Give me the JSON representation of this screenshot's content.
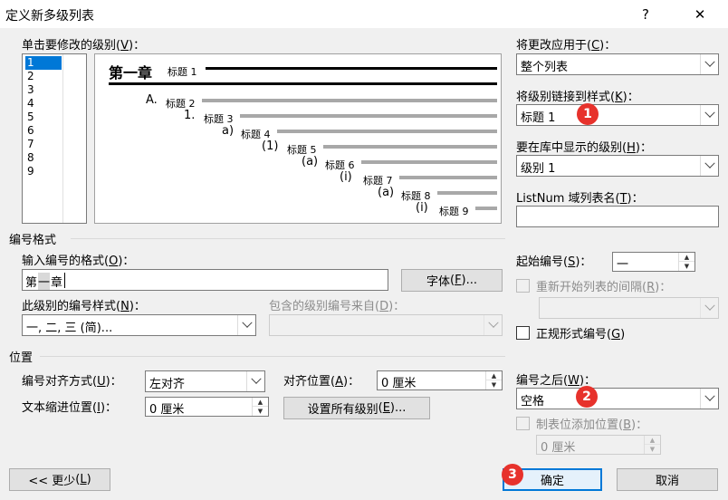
{
  "window": {
    "title": "定义新多级列表",
    "help": "?",
    "close": "✕"
  },
  "level_click": {
    "label": "单击要修改的级别",
    "key": "V",
    "suffix": "："
  },
  "levels": [
    "1",
    "2",
    "3",
    "4",
    "5",
    "6",
    "7",
    "8",
    "9"
  ],
  "selected_level": "1",
  "preview": {
    "chapter_title": "第一章",
    "rows": [
      {
        "num": "",
        "label": "标题 1"
      },
      {
        "num": "A.",
        "label": "标题 2"
      },
      {
        "num": "1.",
        "label": "标题 3"
      },
      {
        "num": "a)",
        "label": "标题 4"
      },
      {
        "num": "(1)",
        "label": "标题 5"
      },
      {
        "num": "(a)",
        "label": "标题 6"
      },
      {
        "num": "(i)",
        "label": "标题 7"
      },
      {
        "num": "(a)",
        "label": "标题 8"
      },
      {
        "num": "(i)",
        "label": "标题 9"
      }
    ]
  },
  "apply_to": {
    "label": "将更改应用于",
    "key": "C",
    "value": "整个列表"
  },
  "link_style": {
    "label": "将级别链接到样式",
    "key": "K",
    "value": "标题 1"
  },
  "gallery_level": {
    "label": "要在库中显示的级别",
    "key": "H",
    "value": "级别 1"
  },
  "listnum": {
    "label": "ListNum 域列表名",
    "key": "T",
    "value": ""
  },
  "number_format": {
    "section": "编号格式",
    "format_label": "输入编号的格式",
    "format_key": "O",
    "format_value_prefix": "第",
    "format_value_field": "一",
    "format_value_suffix": "章",
    "font_button": "字体",
    "font_key": "F",
    "style_label": "此级别的编号样式",
    "style_key": "N",
    "style_value": "一, 二, 三 (简)...",
    "include_label": "包含的级别编号来自",
    "include_key": "D",
    "start_label": "起始编号",
    "start_key": "S",
    "start_value": "一",
    "restart_label": "重新开始列表的间隔",
    "restart_key": "R",
    "legal_label": "正规形式编号",
    "legal_key": "G"
  },
  "position": {
    "section": "位置",
    "align_label": "编号对齐方式",
    "align_key": "U",
    "align_value": "左对齐",
    "align_at_label": "对齐位置",
    "align_at_key": "A",
    "align_at_value": "0 厘米",
    "indent_label": "文本缩进位置",
    "indent_key": "I",
    "indent_value": "0 厘米",
    "set_all_button": "设置所有级别",
    "set_all_key": "E",
    "follow_label": "编号之后",
    "follow_key": "W",
    "follow_value": "空格",
    "tab_label": "制表位添加位置",
    "tab_key": "B",
    "tab_value": "0 厘米"
  },
  "buttons": {
    "less": "<< 更少",
    "less_key": "L",
    "ok": "确定",
    "cancel": "取消"
  },
  "badges": [
    "1",
    "2",
    "3"
  ],
  "colors": {
    "badge": "#e7322c",
    "selection": "#0078d7"
  }
}
